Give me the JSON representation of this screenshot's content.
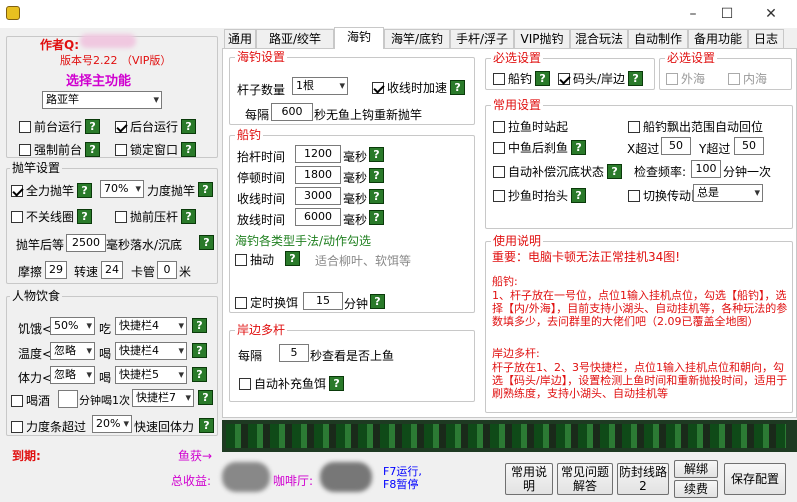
{
  "window": {
    "title": "",
    "minimize": "–",
    "maximize": "☐",
    "close": "✕"
  },
  "colors": {
    "accent_red": "#e01010",
    "accent_magenta": "#d000d0",
    "accent_blue": "#0000ff",
    "help_green": "#2a7a2a"
  },
  "left": {
    "author_label": "作者Q:",
    "version": "版本号2.22 （VIP版）",
    "select_main": "选择主功能",
    "main_select": "路亚竿",
    "front_run": "前台运行",
    "back_run": "后台运行",
    "force_front": "强制前台",
    "lock_window": "锁定窗口",
    "throw_title": "抛竿设置",
    "full_power": "全力抛竿",
    "power_pct": "70%",
    "power_throw": "力度抛竿",
    "no_close_line": "不关线圈",
    "press_rod": "抛前压杆",
    "after_throw": "抛竿后等",
    "after_throw_val": "2500",
    "sink_label": "毫秒落水/沉底",
    "friction": "摩擦",
    "friction_val": "29",
    "speed": "转速",
    "speed_val": "24",
    "clip": "卡管",
    "clip_val": "0",
    "clip_unit": "米",
    "food_title": "人物饮食",
    "hunger": "饥饿<",
    "hunger_val": "50%",
    "eat": "吃",
    "hunger_slot": "快捷栏4",
    "temp": "温度<",
    "temp_val": "忽略",
    "drink": "喝",
    "temp_slot": "快捷栏4",
    "stamina": "体力<",
    "stamina_val": "忽略",
    "stamina_drink": "喝",
    "stamina_slot": "快捷栏5",
    "alcohol": "喝酒",
    "alcohol_unit": "分钟喝1次",
    "alcohol_slot": "快捷栏7",
    "force_over": "力度条超过",
    "force_pct": "20%",
    "fast_recover": "快速回体力",
    "expire": "到期:",
    "fish_get": "鱼获→",
    "total": "总收益:",
    "coffee": "咖啡厅:",
    "hotkeys": "F7运行,\nF8暂停"
  },
  "tabs": [
    {
      "label": "通用"
    },
    {
      "label": "路亚/绞竿"
    },
    {
      "label": "海钓"
    },
    {
      "label": "海竿/底钓"
    },
    {
      "label": "手杆/浮子"
    },
    {
      "label": "VIP抛钓"
    },
    {
      "label": "混合玩法"
    },
    {
      "label": "自动制作"
    },
    {
      "label": "备用功能"
    },
    {
      "label": "日志"
    }
  ],
  "sea": {
    "title": "海钓设置",
    "rod_count": "杆子数量",
    "rod_val": "1根",
    "accelerate": "收线时加速",
    "every": "每隔",
    "every_val": "600",
    "every_unit": "秒无鱼上钩重新抛竿"
  },
  "boat": {
    "title": "船钓",
    "rows": [
      {
        "label": "抬杆时间",
        "value": "1200",
        "unit": "毫秒"
      },
      {
        "label": "停顿时间",
        "value": "1800",
        "unit": "毫秒"
      },
      {
        "label": "收线时间",
        "value": "3000",
        "unit": "毫秒"
      },
      {
        "label": "放线时间",
        "value": "6000",
        "unit": "毫秒"
      }
    ],
    "methods": "海钓各类型手法/动作勾选",
    "twitch": "抽动",
    "twitch_note": "适合柳叶、软饵等",
    "timed_swap": "定时换饵",
    "swap_val": "15",
    "swap_unit": "分钟"
  },
  "shore": {
    "title": "岸边多杆",
    "every": "每隔",
    "every_val": "5",
    "every_unit": "秒查看是否上鱼",
    "auto_bait": "自动补充鱼饵"
  },
  "must1": {
    "title": "必选设置",
    "boat": "船钓",
    "dock": "码头/岸边"
  },
  "must2": {
    "title": "必选设置",
    "outer": "外海",
    "inner": "内海"
  },
  "common": {
    "title": "常用设置",
    "lift": "拉鱼时站起",
    "drift_return": "船钓飘出范围自动回位",
    "mid_stop": "中鱼后刹鱼",
    "x_over": "X超过",
    "x_val": "50",
    "y_over": "Y超过",
    "y_val": "50",
    "auto_fix": "自动补偿沉底状态",
    "check_freq": "检查频率:",
    "freq_val": "100",
    "freq_unit": "分钟一次",
    "lift_head": "抄鱼时抬头",
    "switch_rod": "切换传动比",
    "switch_val": "总是"
  },
  "help": {
    "title": "使用说明",
    "line1": "重要：电脑卡顿无法正常挂机34图!",
    "line2": "船钓:",
    "line3": "1、杆子放在一号位，点位1输入挂机点位，勾选【船钓】，选择【内/外海】，目前支持小湖头、自动挂机等，各种玩法的参数填多少，去问群里的大佬们吧（2.09已覆盖全地图）",
    "line4": "岸边多杆:",
    "line5": "杆子放在1、2、3号快捷栏，点位1输入挂机点位和朝向，勾选【码头/岸边】，设置检测上鱼时间和重新抛投时间，适用于刷熟练度，支持小湖头、自动挂机等"
  },
  "buttons": {
    "manual": "常用说\n明",
    "faq": "常见问题\n解答",
    "anti_stuck": "防封线路\n2",
    "unbind": "解绑",
    "renew": "续费",
    "save": "保存配置"
  }
}
